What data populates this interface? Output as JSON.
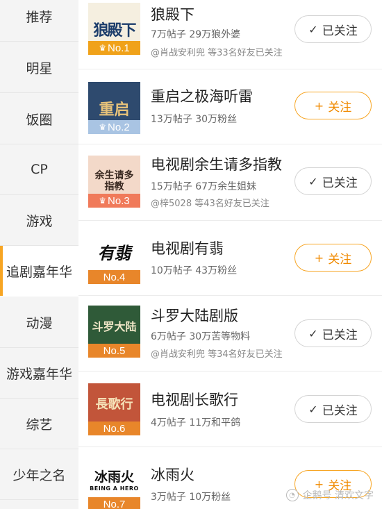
{
  "sidebar": {
    "items": [
      {
        "label": "推荐",
        "active": false
      },
      {
        "label": "明星",
        "active": false
      },
      {
        "label": "饭圈",
        "active": false
      },
      {
        "label": "CP",
        "active": false
      },
      {
        "label": "游戏",
        "active": false
      },
      {
        "label": "追剧嘉年华",
        "active": true
      },
      {
        "label": "动漫",
        "active": false
      },
      {
        "label": "游戏嘉年华",
        "active": false
      },
      {
        "label": "综艺",
        "active": false
      },
      {
        "label": "少年之名",
        "active": false
      }
    ]
  },
  "list": {
    "items": [
      {
        "rank": "No.1",
        "title": "狼殿下",
        "stats": "7万帖子  29万狼外婆",
        "friends": "@肖战安利兜 等33名好友已关注",
        "button": "已关注",
        "followed": true,
        "cover_text": "狼殿下"
      },
      {
        "rank": "No.2",
        "title": "重启之极海听雷",
        "stats": "13万帖子  30万粉丝",
        "friends": "",
        "button": "关注",
        "followed": false,
        "cover_text": "重启"
      },
      {
        "rank": "No.3",
        "title": "电视剧余生请多指教",
        "stats": "15万帖子  67万余生姐妹",
        "friends": "@梓5028 等43名好友已关注",
        "button": "已关注",
        "followed": true,
        "cover_text": "余生请多指教"
      },
      {
        "rank": "No.4",
        "title": "电视剧有翡",
        "stats": "10万帖子  43万粉丝",
        "friends": "",
        "button": "关注",
        "followed": false,
        "cover_text": "有翡"
      },
      {
        "rank": "No.5",
        "title": "斗罗大陆剧版",
        "stats": "6万帖子  30万苦等物料",
        "friends": "@肖战安利兜 等34名好友已关注",
        "button": "已关注",
        "followed": true,
        "cover_text": "斗罗大陆"
      },
      {
        "rank": "No.6",
        "title": "电视剧长歌行",
        "stats": "4万帖子  11万和平鸽",
        "friends": "",
        "button": "已关注",
        "followed": true,
        "cover_text": "長歌行"
      },
      {
        "rank": "No.7",
        "title": "冰雨火",
        "stats": "3万帖子  10万粉丝",
        "friends": "",
        "button": "关注",
        "followed": false,
        "cover_text": "冰雨火",
        "cover_subtext": "BEING A HERO"
      }
    ]
  },
  "watermark": "企鹅号 清欢文字",
  "colors": {
    "accent": "#f7a523",
    "rank1": "#f0a21a",
    "rank2": "#a9c4e3",
    "rank3": "#f07a5a",
    "rank_other": "#e8862a"
  }
}
